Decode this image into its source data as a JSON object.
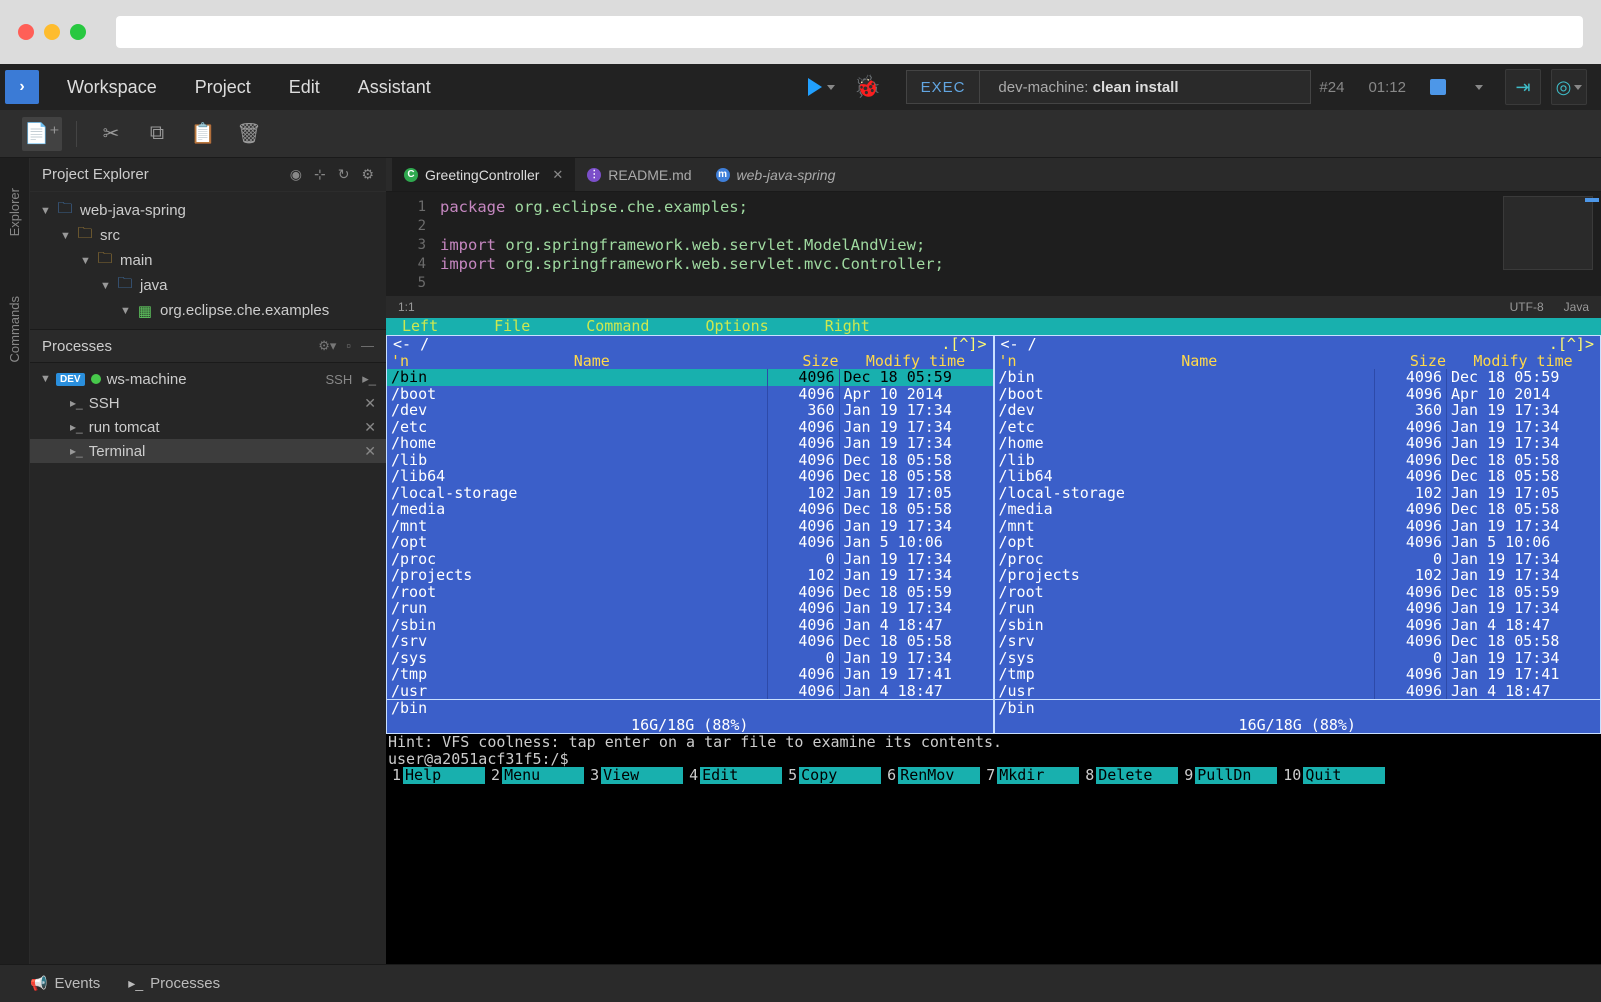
{
  "menubar": {
    "items": [
      "Workspace",
      "Project",
      "Edit",
      "Assistant"
    ],
    "exec_label": "EXEC",
    "exec_target": "dev-machine:",
    "exec_cmd": "clean install",
    "run_number": "#24",
    "run_time": "01:12"
  },
  "left_rail": {
    "explorer": "Explorer",
    "commands": "Commands"
  },
  "project_explorer": {
    "title": "Project Explorer",
    "tree": [
      {
        "indent": 0,
        "icon": "folder-blue",
        "label": "web-java-spring"
      },
      {
        "indent": 1,
        "icon": "folder-gold",
        "label": "src"
      },
      {
        "indent": 2,
        "icon": "folder-gold",
        "label": "main"
      },
      {
        "indent": 3,
        "icon": "folder-blue",
        "label": "java"
      },
      {
        "indent": 4,
        "icon": "package",
        "label": "org.eclipse.che.examples"
      }
    ]
  },
  "processes": {
    "title": "Processes",
    "machine": "ws-machine",
    "machine_badge": "DEV",
    "ssh_label": "SSH",
    "items": [
      {
        "label": "SSH"
      },
      {
        "label": "run tomcat"
      },
      {
        "label": "Terminal",
        "selected": true
      }
    ]
  },
  "tabs": [
    {
      "label": "GreetingController",
      "icon_bg": "#2fa84f",
      "icon_text": "C",
      "active": true,
      "closable": true
    },
    {
      "label": "README.md",
      "icon_bg": "#7b4fc9",
      "icon_text": "⋮"
    },
    {
      "label": "web-java-spring",
      "icon_bg": "#3f7fd9",
      "icon_text": "m",
      "italic": true
    }
  ],
  "code": {
    "lines": [
      {
        "n": 1,
        "html": "<span class='kw'>package</span> <span class='pkg-hl'>org.eclipse.che.examples;</span>"
      },
      {
        "n": 2,
        "html": ""
      },
      {
        "n": 3,
        "html": "<span class='kw'>import</span> <span class='pkg-hl'>org.springframework.web.servlet.ModelAndView;</span>"
      },
      {
        "n": 4,
        "html": "<span class='kw'>import</span> <span class='pkg-hl'>org.springframework.web.servlet.mvc.Controller;</span>"
      },
      {
        "n": 5,
        "html": ""
      }
    ],
    "cursor": "1:1",
    "encoding": "UTF-8",
    "language": "Java"
  },
  "mc": {
    "menu": [
      "Left",
      "File",
      "Command",
      "Options",
      "Right"
    ],
    "path": "/",
    "path_decor_left": "<-",
    "path_decor_right": ".[^]>",
    "cols": {
      "n": "'n",
      "name": "Name",
      "size": "Size",
      "mtime": "Modify time"
    },
    "rows": [
      {
        "name": "/bin",
        "size": "4096",
        "mtime": "Dec 18 05:59",
        "hl": true
      },
      {
        "name": "/boot",
        "size": "4096",
        "mtime": "Apr 10  2014"
      },
      {
        "name": "/dev",
        "size": "360",
        "mtime": "Jan 19 17:34"
      },
      {
        "name": "/etc",
        "size": "4096",
        "mtime": "Jan 19 17:34"
      },
      {
        "name": "/home",
        "size": "4096",
        "mtime": "Jan 19 17:34"
      },
      {
        "name": "/lib",
        "size": "4096",
        "mtime": "Dec 18 05:58"
      },
      {
        "name": "/lib64",
        "size": "4096",
        "mtime": "Dec 18 05:58"
      },
      {
        "name": "/local-storage",
        "size": "102",
        "mtime": "Jan 19 17:05"
      },
      {
        "name": "/media",
        "size": "4096",
        "mtime": "Dec 18 05:58"
      },
      {
        "name": "/mnt",
        "size": "4096",
        "mtime": "Jan 19 17:34"
      },
      {
        "name": "/opt",
        "size": "4096",
        "mtime": "Jan  5 10:06"
      },
      {
        "name": "/proc",
        "size": "0",
        "mtime": "Jan 19 17:34"
      },
      {
        "name": "/projects",
        "size": "102",
        "mtime": "Jan 19 17:34"
      },
      {
        "name": "/root",
        "size": "4096",
        "mtime": "Dec 18 05:59"
      },
      {
        "name": "/run",
        "size": "4096",
        "mtime": "Jan 19 17:34"
      },
      {
        "name": "/sbin",
        "size": "4096",
        "mtime": "Jan  4 18:47"
      },
      {
        "name": "/srv",
        "size": "4096",
        "mtime": "Dec 18 05:58"
      },
      {
        "name": "/sys",
        "size": "0",
        "mtime": "Jan 19 17:34"
      },
      {
        "name": "/tmp",
        "size": "4096",
        "mtime": "Jan 19 17:41"
      },
      {
        "name": "/usr",
        "size": "4096",
        "mtime": "Jan  4 18:47"
      }
    ],
    "selected": "/bin",
    "disk": "16G/18G (88%)",
    "hint": "Hint: VFS coolness: tap enter on a tar file to examine its contents.",
    "prompt": "user@a2051acf31f5:/$",
    "fkeys": [
      {
        "n": "1",
        "l": "Help"
      },
      {
        "n": "2",
        "l": "Menu"
      },
      {
        "n": "3",
        "l": "View"
      },
      {
        "n": "4",
        "l": "Edit"
      },
      {
        "n": "5",
        "l": "Copy"
      },
      {
        "n": "6",
        "l": "RenMov"
      },
      {
        "n": "7",
        "l": "Mkdir"
      },
      {
        "n": "8",
        "l": "Delete"
      },
      {
        "n": "9",
        "l": "PullDn"
      },
      {
        "n": "10",
        "l": "Quit"
      }
    ]
  },
  "bottom_bar": {
    "events": "Events",
    "processes": "Processes"
  }
}
